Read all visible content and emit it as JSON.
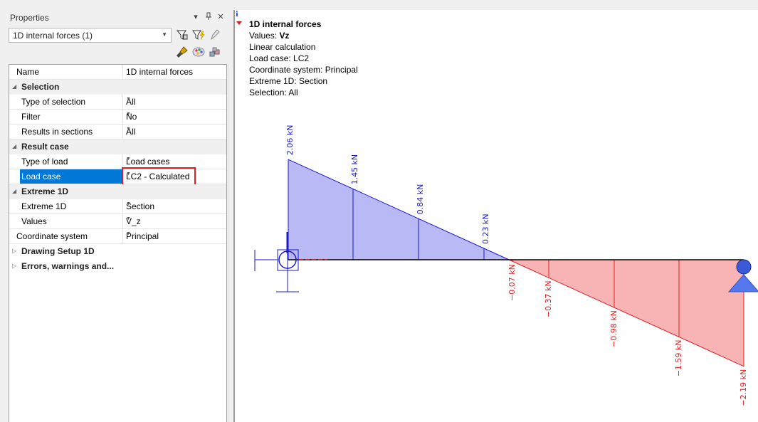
{
  "panel": {
    "title": "Properties",
    "pin_icon": "pin-icon",
    "close_label": "✕",
    "selector_value": "1D internal forces (1)",
    "tools": [
      "filter-select-icon",
      "filter-lightning-icon",
      "pencil-icon",
      "brush-icon",
      "palette-icon",
      "cubes-icon"
    ]
  },
  "grid": {
    "name_label": "Name",
    "name_value": "1D internal forces",
    "selection": {
      "header": "Selection",
      "type_of_selection_label": "Type of selection",
      "type_of_selection_value": "All",
      "filter_label": "Filter",
      "filter_value": "No",
      "results_in_sections_label": "Results in sections",
      "results_in_sections_value": "All"
    },
    "result_case": {
      "header": "Result case",
      "type_of_load_label": "Type of load",
      "type_of_load_value": "Load cases",
      "load_case_label": "Load case",
      "load_case_value": "LC2 - Calculated"
    },
    "extreme_1d": {
      "header": "Extreme 1D",
      "extreme_label": "Extreme 1D",
      "extreme_value": "Section",
      "values_label": "Values",
      "values_value": "V_z"
    },
    "coordinate_system_label": "Coordinate system",
    "coordinate_system_value": "Principal",
    "drawing_setup": "Drawing Setup 1D",
    "errors": "Errors, warnings and..."
  },
  "view": {
    "title": "1D internal forces",
    "values_prefix": "Values: ",
    "values_symbol": "Vz",
    "calc": "Linear calculation",
    "load_case": "Load case: LC2",
    "coord": "Coordinate system: Principal",
    "extreme": "Extreme 1D: Section",
    "selection": "Selection: All"
  },
  "chart_data": {
    "type": "area",
    "positive_color": "#b9b9f5",
    "negative_color": "#f8b4b4",
    "positive_line": "#1a1acc",
    "negative_line": "#e02020",
    "points": [
      {
        "label": "2.06 kN",
        "value": 2.06
      },
      {
        "label": "1.45 kN",
        "value": 1.45
      },
      {
        "label": "0.84 kN",
        "value": 0.84
      },
      {
        "label": "0.23 kN",
        "value": 0.23
      },
      {
        "label": "-0.07 kN",
        "value": -0.07
      },
      {
        "label": "-0.37 kN",
        "value": -0.37
      },
      {
        "label": "-0.98 kN",
        "value": -0.98
      },
      {
        "label": "-1.59 kN",
        "value": -1.59
      },
      {
        "label": "-2.19 kN",
        "value": -2.19
      }
    ]
  }
}
